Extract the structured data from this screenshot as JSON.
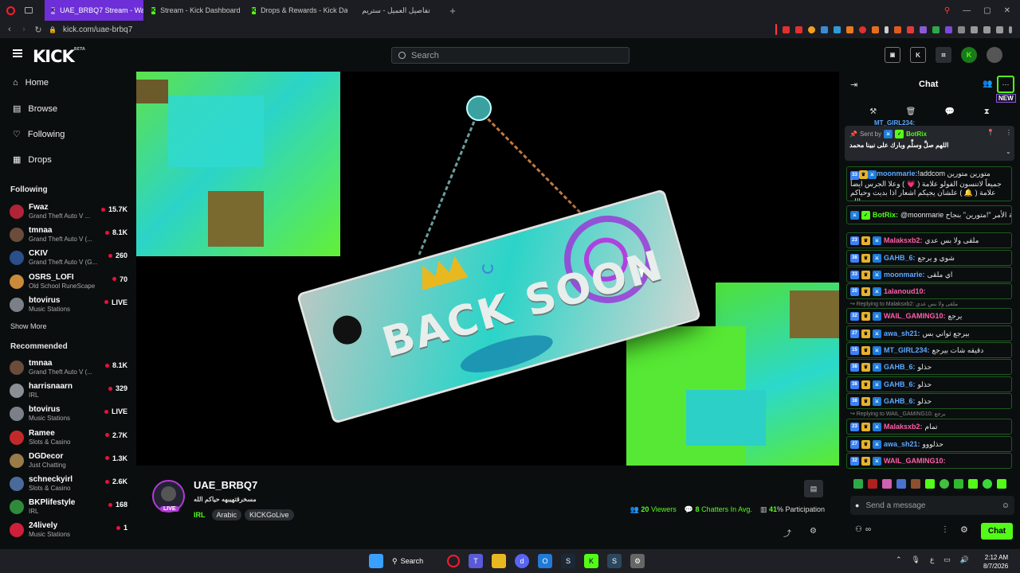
{
  "browser": {
    "tabs": [
      {
        "label": "UAE_BRBQ7 Stream - Watc",
        "active": true
      },
      {
        "label": "Stream - Kick Dashboard",
        "active": false
      },
      {
        "label": "Drops & Rewards - Kick Da",
        "active": false
      },
      {
        "label": "تفاصيل العميل - ستريم",
        "active": false
      }
    ],
    "new_tab": "+",
    "url": "kick.com/uae-brbq7"
  },
  "header": {
    "logo": "KICK",
    "logo_sup": "BETA",
    "search_placeholder": "Search"
  },
  "sidebar": {
    "nav": [
      {
        "label": "Home",
        "icon": "home-icon"
      },
      {
        "label": "Browse",
        "icon": "browse-icon"
      },
      {
        "label": "Following",
        "icon": "heart-icon"
      },
      {
        "label": "Drops",
        "icon": "drops-icon"
      }
    ],
    "following_title": "Following",
    "following": [
      {
        "name": "Fwaz",
        "game": "Grand Theft Auto V ...",
        "viewers": "15.7K",
        "color": "#b0243a"
      },
      {
        "name": "tmnaa",
        "game": "Grand Theft Auto V (...",
        "viewers": "8.1K",
        "color": "#6b4b3a"
      },
      {
        "name": "CKIV",
        "game": "Grand Theft Auto V (G...",
        "viewers": "260",
        "color": "#2a4f8a"
      },
      {
        "name": "OSRS_LOFI",
        "game": "Old School RuneScape",
        "viewers": "70",
        "color": "#c98a3a"
      },
      {
        "name": "btovirus",
        "game": "Music Stations",
        "viewers": "LIVE",
        "color": "#7a7f88"
      }
    ],
    "show_more": "Show More",
    "recommended_title": "Recommended",
    "recommended": [
      {
        "name": "tmnaa",
        "game": "Grand Theft Auto V (...",
        "viewers": "8.1K",
        "color": "#6b4b3a"
      },
      {
        "name": "harrisnaarn",
        "game": "IRL",
        "viewers": "329",
        "color": "#8a8f96"
      },
      {
        "name": "btovirus",
        "game": "Music Stations",
        "viewers": "LIVE",
        "color": "#7a7f88"
      },
      {
        "name": "Ramee",
        "game": "Slots & Casino",
        "viewers": "2.7K",
        "color": "#c22a2a"
      },
      {
        "name": "DGDecor",
        "game": "Just Chatting",
        "viewers": "1.3K",
        "color": "#9a7b4a"
      },
      {
        "name": "schneckyirl",
        "game": "Slots & Casino",
        "viewers": "2.6K",
        "color": "#4a6a9a"
      },
      {
        "name": "BKPlifestyle",
        "game": "IRL",
        "viewers": "168",
        "color": "#2f8a3a"
      },
      {
        "name": "24lively",
        "game": "Music Stations",
        "viewers": "1",
        "color": "#d01f3a"
      }
    ]
  },
  "video": {
    "sign_text": "BACK SOON"
  },
  "stream": {
    "channel": "UAE_BRBQ7",
    "live_badge": "LIVE",
    "title": "مسخرقتهيبهه حياكم الله",
    "tags": [
      "IRL",
      "Arabic",
      "KICKGoLive"
    ],
    "viewers": "20",
    "viewers_label": "Viewers",
    "chatters": "8",
    "chatters_label": "Chatters In Avg.",
    "participation": "41",
    "participation_label": "% Participation"
  },
  "chat": {
    "title": "Chat",
    "new_badge": "NEW",
    "pinned_top_user": "MT_GIRL234:",
    "pinned_sent_by": "Sent by",
    "pinned_user": "BotRix",
    "pinned_text": "اللهم صلِّ وسلِّم وبارك على نبينا محمد",
    "messages": [
      {
        "user": "moonmarie:",
        "color": "#5ea8ff",
        "sub": "33",
        "text": "!addcom متورين متورين جميعاً لاتنسون الفولو علامة ( 💗 ) وعلا الجرس ايضاً علامة ( 🔔 ) علشان يجيكم اشعار اذا بديت وحياكم الله"
      },
      {
        "user": "BotRix:",
        "color": "#53fc18",
        "sub": "",
        "text": "@moonmarie تمت إضافة الأمر \"!متورين\" بنجاح."
      },
      {
        "user": "Malaksxb2:",
        "color": "#ff5fa8",
        "sub": "23",
        "text": "ملقى ولا بس عدي"
      },
      {
        "user": "GAHB_6:",
        "color": "#5ea8ff",
        "sub": "38",
        "text": "شوي و يرجع"
      },
      {
        "user": "moonmarie:",
        "color": "#5ea8ff",
        "sub": "33",
        "text": "اي ملقى"
      },
      {
        "user": "1alanoud10:",
        "color": "#ff5fa8",
        "sub": "20",
        "text": ""
      },
      {
        "reply": "Replying to Malaksxb2: ملقى ولا بس عدي"
      },
      {
        "user": "WAIL_GAMING10:",
        "color": "#ff5fa8",
        "sub": "32",
        "text": "يرجع"
      },
      {
        "user": "awa_sh21:",
        "color": "#5ea8ff",
        "sub": "27",
        "text": "بيرجع ثواني بس"
      },
      {
        "user": "MT_GIRL234:",
        "color": "#5ea8ff",
        "sub": "15",
        "text": "دقيقه شات بيرجع"
      },
      {
        "user": "GAHB_6:",
        "color": "#5ea8ff",
        "sub": "38",
        "text": "حذلو"
      },
      {
        "user": "GAHB_6:",
        "color": "#5ea8ff",
        "sub": "38",
        "text": "حذلو"
      },
      {
        "user": "GAHB_6:",
        "color": "#5ea8ff",
        "sub": "38",
        "text": "حذلو"
      },
      {
        "reply": "Replying to WAIL_GAMING10: يرجع"
      },
      {
        "user": "Malaksxb2:",
        "color": "#ff5fa8",
        "sub": "23",
        "text": "تمام"
      },
      {
        "user": "awa_sh21:",
        "color": "#5ea8ff",
        "sub": "27",
        "text": "حذلووو"
      },
      {
        "user": "WAIL_GAMING10:",
        "color": "#ff5fa8",
        "sub": "32",
        "text": ""
      }
    ],
    "input_placeholder": "Send a message",
    "chat_button": "Chat"
  },
  "taskbar": {
    "search": "Search",
    "lang": "ع",
    "time": "2:12 AM",
    "date": "8/7/2026"
  },
  "colors": {
    "kick_green": "#53fc18",
    "tab_purple": "#6e2fd8",
    "live_red": "#e9113c"
  }
}
